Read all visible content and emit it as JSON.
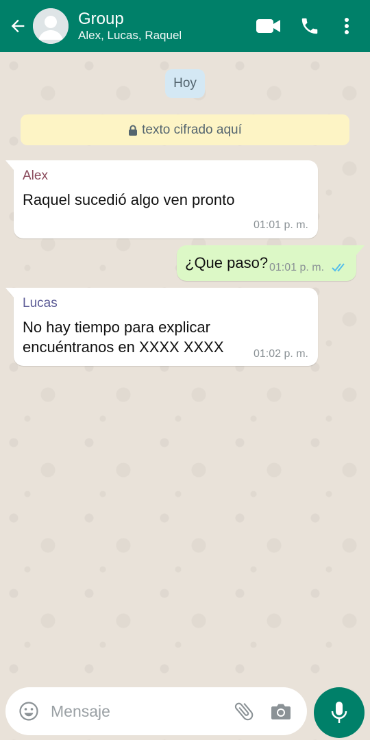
{
  "colors": {
    "header": "#008069",
    "outgoing_bubble": "#dcf8c6",
    "date_chip": "#d4e8f4",
    "encryption_note": "#fdf4c5",
    "read_ticks": "#53bdeb"
  },
  "header": {
    "title": "Group",
    "participants": "Alex, Lucas, Raquel",
    "icons": [
      "back-arrow-icon",
      "video-call-icon",
      "voice-call-icon",
      "more-options-icon"
    ]
  },
  "chat": {
    "date_label": "Hoy",
    "encryption_notice": "texto cifrado aquí",
    "messages": [
      {
        "direction": "in",
        "sender": "Alex",
        "sender_color": "#8a4a5b",
        "lines": [
          "Raquel sucedió algo ven pronto"
        ],
        "time": "01:01 p. m."
      },
      {
        "direction": "out",
        "lines": [
          "¿Que paso?"
        ],
        "time": "01:01 p. m.",
        "status": "read"
      },
      {
        "direction": "in",
        "sender": "Lucas",
        "sender_color": "#5b5a95",
        "lines": [
          "No hay tiempo para explicar",
          "encuéntranos en XXXX XXXX"
        ],
        "time": "01:02 p. m."
      }
    ]
  },
  "composer": {
    "placeholder": "Mensaje",
    "icons": [
      "emoji-icon",
      "attach-icon",
      "camera-icon",
      "mic-icon"
    ]
  }
}
